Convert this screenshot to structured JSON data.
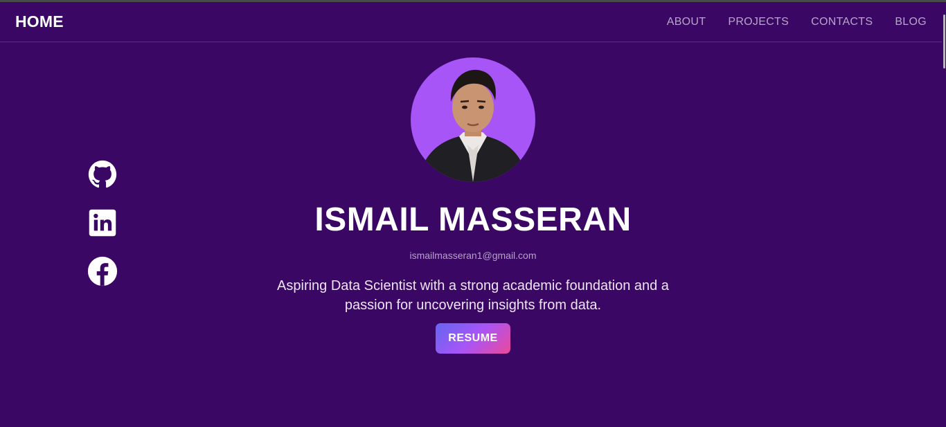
{
  "nav": {
    "brand": "HOME",
    "links": [
      "ABOUT",
      "PROJECTS",
      "CONTACTS",
      "BLOG"
    ]
  },
  "social": {
    "items": [
      {
        "icon": "github-icon"
      },
      {
        "icon": "linkedin-icon"
      },
      {
        "icon": "facebook-icon"
      }
    ]
  },
  "profile": {
    "name": "ISMAIL MASSERAN",
    "email": "ismailmasseran1@gmail.com",
    "tagline": "Aspiring Data Scientist with a strong academic foundation and a passion for uncovering insights from data.",
    "resume_label": "RESUME"
  },
  "colors": {
    "background": "#3b0764",
    "avatar_bg": "#a855f7",
    "button_gradient": [
      "#6366f1",
      "#a855f7",
      "#ec4899"
    ]
  }
}
